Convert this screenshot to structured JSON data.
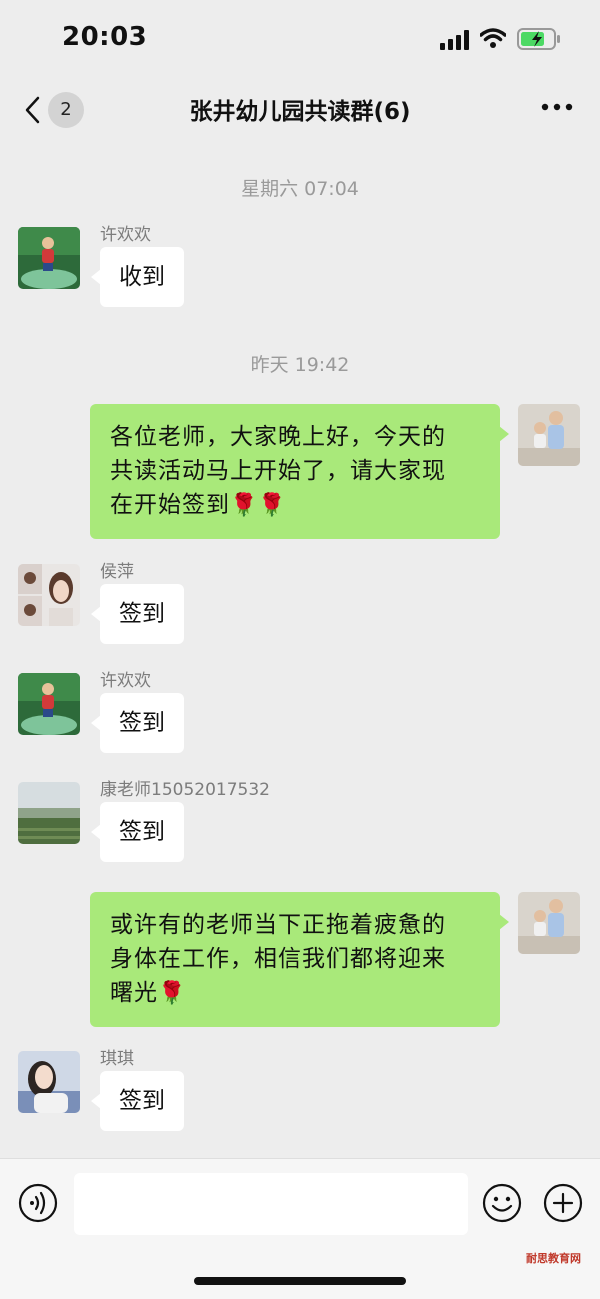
{
  "status_bar": {
    "time": "20:03"
  },
  "nav": {
    "badge": "2",
    "title": "张井幼儿园共读群(6)"
  },
  "messages": {
    "sep1": "星期六 07:04",
    "m1": {
      "sender": "许欢欢",
      "text": "收到"
    },
    "sep2": "昨天 19:42",
    "m2": {
      "line1": "各位老师，大家晚上好，今天的",
      "line2": "共读活动马上开始了，请大家现",
      "line3": "在开始签到",
      "emoji": "🌹"
    },
    "m3": {
      "sender": "侯萍",
      "text": "签到"
    },
    "m4": {
      "sender": "许欢欢",
      "text": "签到"
    },
    "m5": {
      "sender": "康老师15052017532",
      "text": "签到"
    },
    "m6": {
      "line1": "或许有的老师当下正拖着疲惫的",
      "line2": "身体在工作，相信我们都将迎来",
      "line3": "曙光",
      "emoji": "🌹"
    },
    "m7": {
      "sender": "琪琪",
      "text": "签到"
    }
  },
  "input_bar": {
    "placeholder": ""
  },
  "watermark": "耐思教育网",
  "colors": {
    "outgoing_bubble": "#a9e97a",
    "incoming_bubble": "#ffffff",
    "background": "#ededed"
  }
}
